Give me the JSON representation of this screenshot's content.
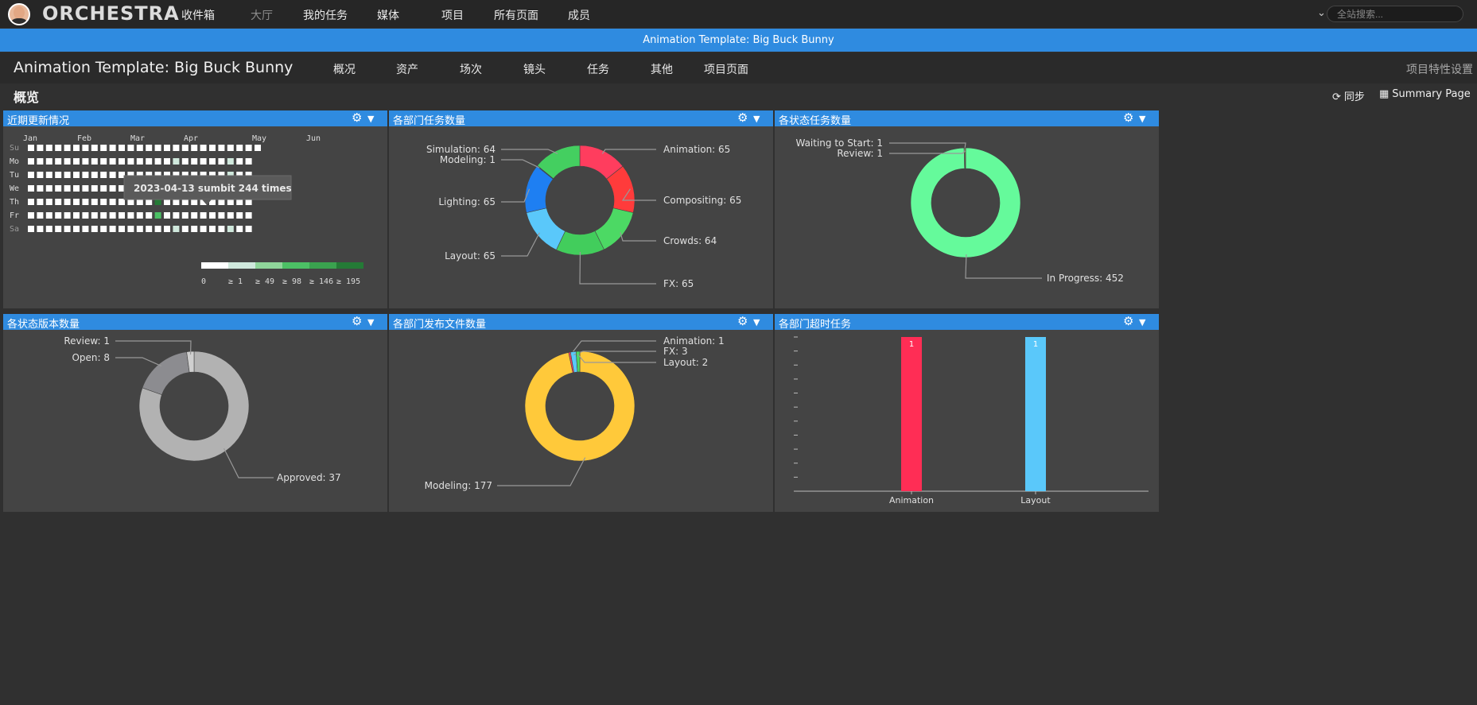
{
  "topnav": {
    "brand": "ORCHESTRA",
    "items": [
      {
        "label": "收件箱"
      },
      {
        "label": "大厅"
      },
      {
        "label": "我的任务"
      },
      {
        "label": "媒体"
      },
      {
        "label": "项目"
      },
      {
        "label": "所有页面"
      },
      {
        "label": "成员"
      }
    ],
    "search_placeholder": "全站搜索..."
  },
  "banner": {
    "text": "Animation Template: Big Buck Bunny"
  },
  "project": {
    "title": "Animation Template: Big Buck Bunny",
    "tabs": [
      {
        "label": "概况"
      },
      {
        "label": "资产"
      },
      {
        "label": "场次"
      },
      {
        "label": "镜头"
      },
      {
        "label": "任务"
      },
      {
        "label": "其他"
      },
      {
        "label": "项目页面"
      }
    ],
    "settings_label": "项目特性设置"
  },
  "section": {
    "title": "概览",
    "sync_label": "同步",
    "summary_label": "Summary Page"
  },
  "icons": {
    "gear": "gear-icon",
    "caret": "caret-down-icon",
    "sync": "sync-icon",
    "summary": "grid-icon"
  },
  "colors": {
    "accent": "#2f8be0",
    "tooltip_bg": "#5a5a5a"
  },
  "panels": [
    {
      "title": "近期更新情况"
    },
    {
      "title": "各部门任务数量"
    },
    {
      "title": "各状态任务数量"
    },
    {
      "title": "各状态版本数量"
    },
    {
      "title": "各部门发布文件数量"
    },
    {
      "title": "各部门超时任务"
    }
  ],
  "heatmap": {
    "months": [
      "Jan",
      "Feb",
      "Mar",
      "Apr",
      "May",
      "Jun"
    ],
    "days": [
      "Su",
      "Mo",
      "Tu",
      "We",
      "Th",
      "Fr",
      "Sa"
    ],
    "tooltip": "2023-04-13 sumbit 244 times",
    "legend": [
      "0",
      "≥ 1",
      "≥ 49",
      "≥ 98",
      "≥ 146",
      "≥ 195"
    ],
    "legend_colors": [
      "#ffffff",
      "#cfe8dc",
      "#8fd59a",
      "#4cc065",
      "#3aa24f",
      "#247a36"
    ]
  },
  "chart_data": [
    {
      "type": "pie",
      "title": "各部门任务数量",
      "slices": [
        {
          "label": "Animation",
          "value": 65,
          "color": "#ff3d5e"
        },
        {
          "label": "Compositing",
          "value": 65,
          "color": "#ff3b3b"
        },
        {
          "label": "Crowds",
          "value": 64,
          "color": "#4cd964"
        },
        {
          "label": "FX",
          "value": 65,
          "color": "#42cd5c"
        },
        {
          "label": "Layout",
          "value": 65,
          "color": "#5ac8fa"
        },
        {
          "label": "Lighting",
          "value": 65,
          "color": "#1e7ff2"
        },
        {
          "label": "Modeling",
          "value": 1,
          "color": "#2a5fd8"
        },
        {
          "label": "Simulation",
          "value": 64,
          "color": "#44cf60"
        }
      ]
    },
    {
      "type": "pie",
      "title": "各状态任务数量",
      "slices": [
        {
          "label": "In Progress",
          "value": 452,
          "color": "#65fa9b"
        },
        {
          "label": "Waiting to Start",
          "value": 1,
          "color": "#9a9a9a"
        },
        {
          "label": "Review",
          "value": 1,
          "color": "#d9c45a"
        }
      ]
    },
    {
      "type": "pie",
      "title": "各状态版本数量",
      "slices": [
        {
          "label": "Approved",
          "value": 37,
          "color": "#b2b2b2"
        },
        {
          "label": "Open",
          "value": 8,
          "color": "#8c8c90"
        },
        {
          "label": "Review",
          "value": 1,
          "color": "#cfcfcf"
        }
      ]
    },
    {
      "type": "pie",
      "title": "各部门发布文件数量",
      "slices": [
        {
          "label": "Modeling",
          "value": 177,
          "color": "#ffc93a"
        },
        {
          "label": "Animation",
          "value": 1,
          "color": "#ff3d5e"
        },
        {
          "label": "FX",
          "value": 3,
          "color": "#5ac8fa"
        },
        {
          "label": "Layout",
          "value": 2,
          "color": "#4cd964"
        }
      ]
    },
    {
      "type": "bar",
      "title": "各部门超时任务",
      "categories": [
        "Animation",
        "Layout"
      ],
      "values": [
        1,
        1
      ],
      "colors": [
        "#ff2d55",
        "#5ac8fa"
      ],
      "ylim": [
        0,
        1
      ]
    }
  ]
}
